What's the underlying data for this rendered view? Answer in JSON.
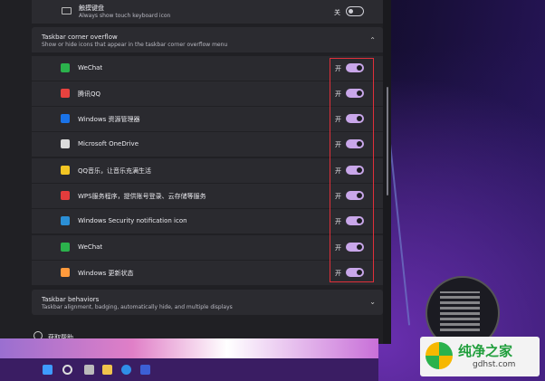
{
  "top_row": {
    "title": "触摸键盘",
    "subtitle": "Always show touch keyboard icon",
    "state": "关"
  },
  "overflow": {
    "title": "Taskbar corner overflow",
    "subtitle": "Show or hide icons that appear in the taskbar corner overflow menu",
    "items": [
      {
        "label": "WeChat",
        "state": "开",
        "icon": "wechat-icon",
        "color": "#2bb24c"
      },
      {
        "label": "腾讯QQ",
        "state": "开",
        "icon": "qq-icon",
        "color": "#e8423f"
      },
      {
        "label": "Windows 资源管理器",
        "state": "开",
        "icon": "bluetooth-icon",
        "color": "#1a73e8"
      },
      {
        "label": "Microsoft OneDrive",
        "state": "开",
        "icon": "onedrive-icon",
        "color": "#dcdcdc"
      },
      {
        "label": "QQ音乐，让音乐充满生活",
        "state": "开",
        "icon": "qqmusic-icon",
        "color": "#f3c623"
      },
      {
        "label": "WPS服务程序，提供账号登录、云存储等服务",
        "state": "开",
        "icon": "wps-icon",
        "color": "#e33c3c"
      },
      {
        "label": "Windows Security notification icon",
        "state": "开",
        "icon": "security-icon",
        "color": "#2b8fd6"
      },
      {
        "label": "WeChat",
        "state": "开",
        "icon": "wechat-icon",
        "color": "#2bb24c"
      },
      {
        "label": "Windows 更新状态",
        "state": "开",
        "icon": "windows-update-icon",
        "color": "#ff9a3c"
      }
    ]
  },
  "behaviors": {
    "title": "Taskbar behaviors",
    "subtitle": "Taskbar alignment, badging, automatically hide, and multiple displays"
  },
  "help": {
    "label": "获取帮助"
  },
  "watermark": {
    "title": "纯净之家",
    "url": "gdhst.com"
  }
}
